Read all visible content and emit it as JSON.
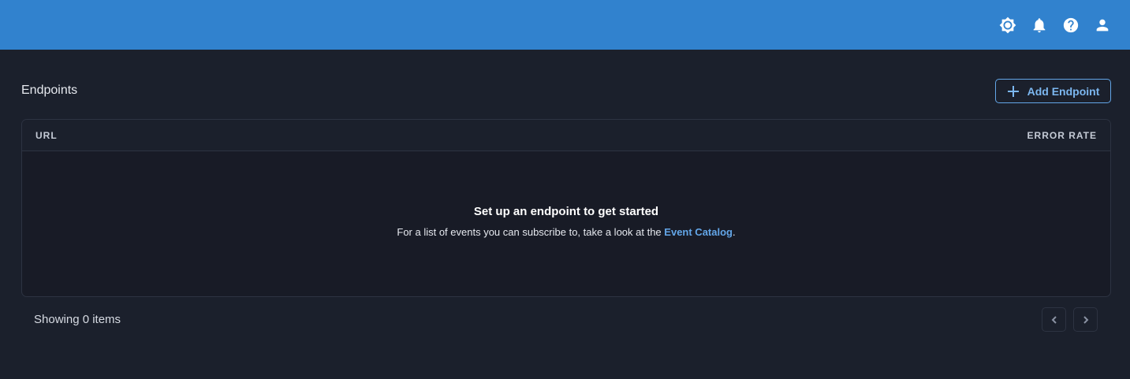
{
  "header": {
    "icons": [
      "theme-toggle-icon",
      "notifications-icon",
      "help-icon",
      "user-icon"
    ]
  },
  "section": {
    "title": "Endpoints",
    "add_button_label": "Add Endpoint"
  },
  "table": {
    "columns": [
      "URL",
      "ERROR RATE"
    ],
    "empty_title": "Set up an endpoint to get started",
    "empty_text": "For a list of events you can subscribe to, take a look at the",
    "empty_link": "Event Catalog",
    "empty_suffix": "."
  },
  "footer": {
    "showing_text": "Showing 0 items"
  },
  "colors": {
    "header_bg": "#3182ce",
    "page_bg": "#1b202c",
    "accent": "#63a6e8"
  }
}
